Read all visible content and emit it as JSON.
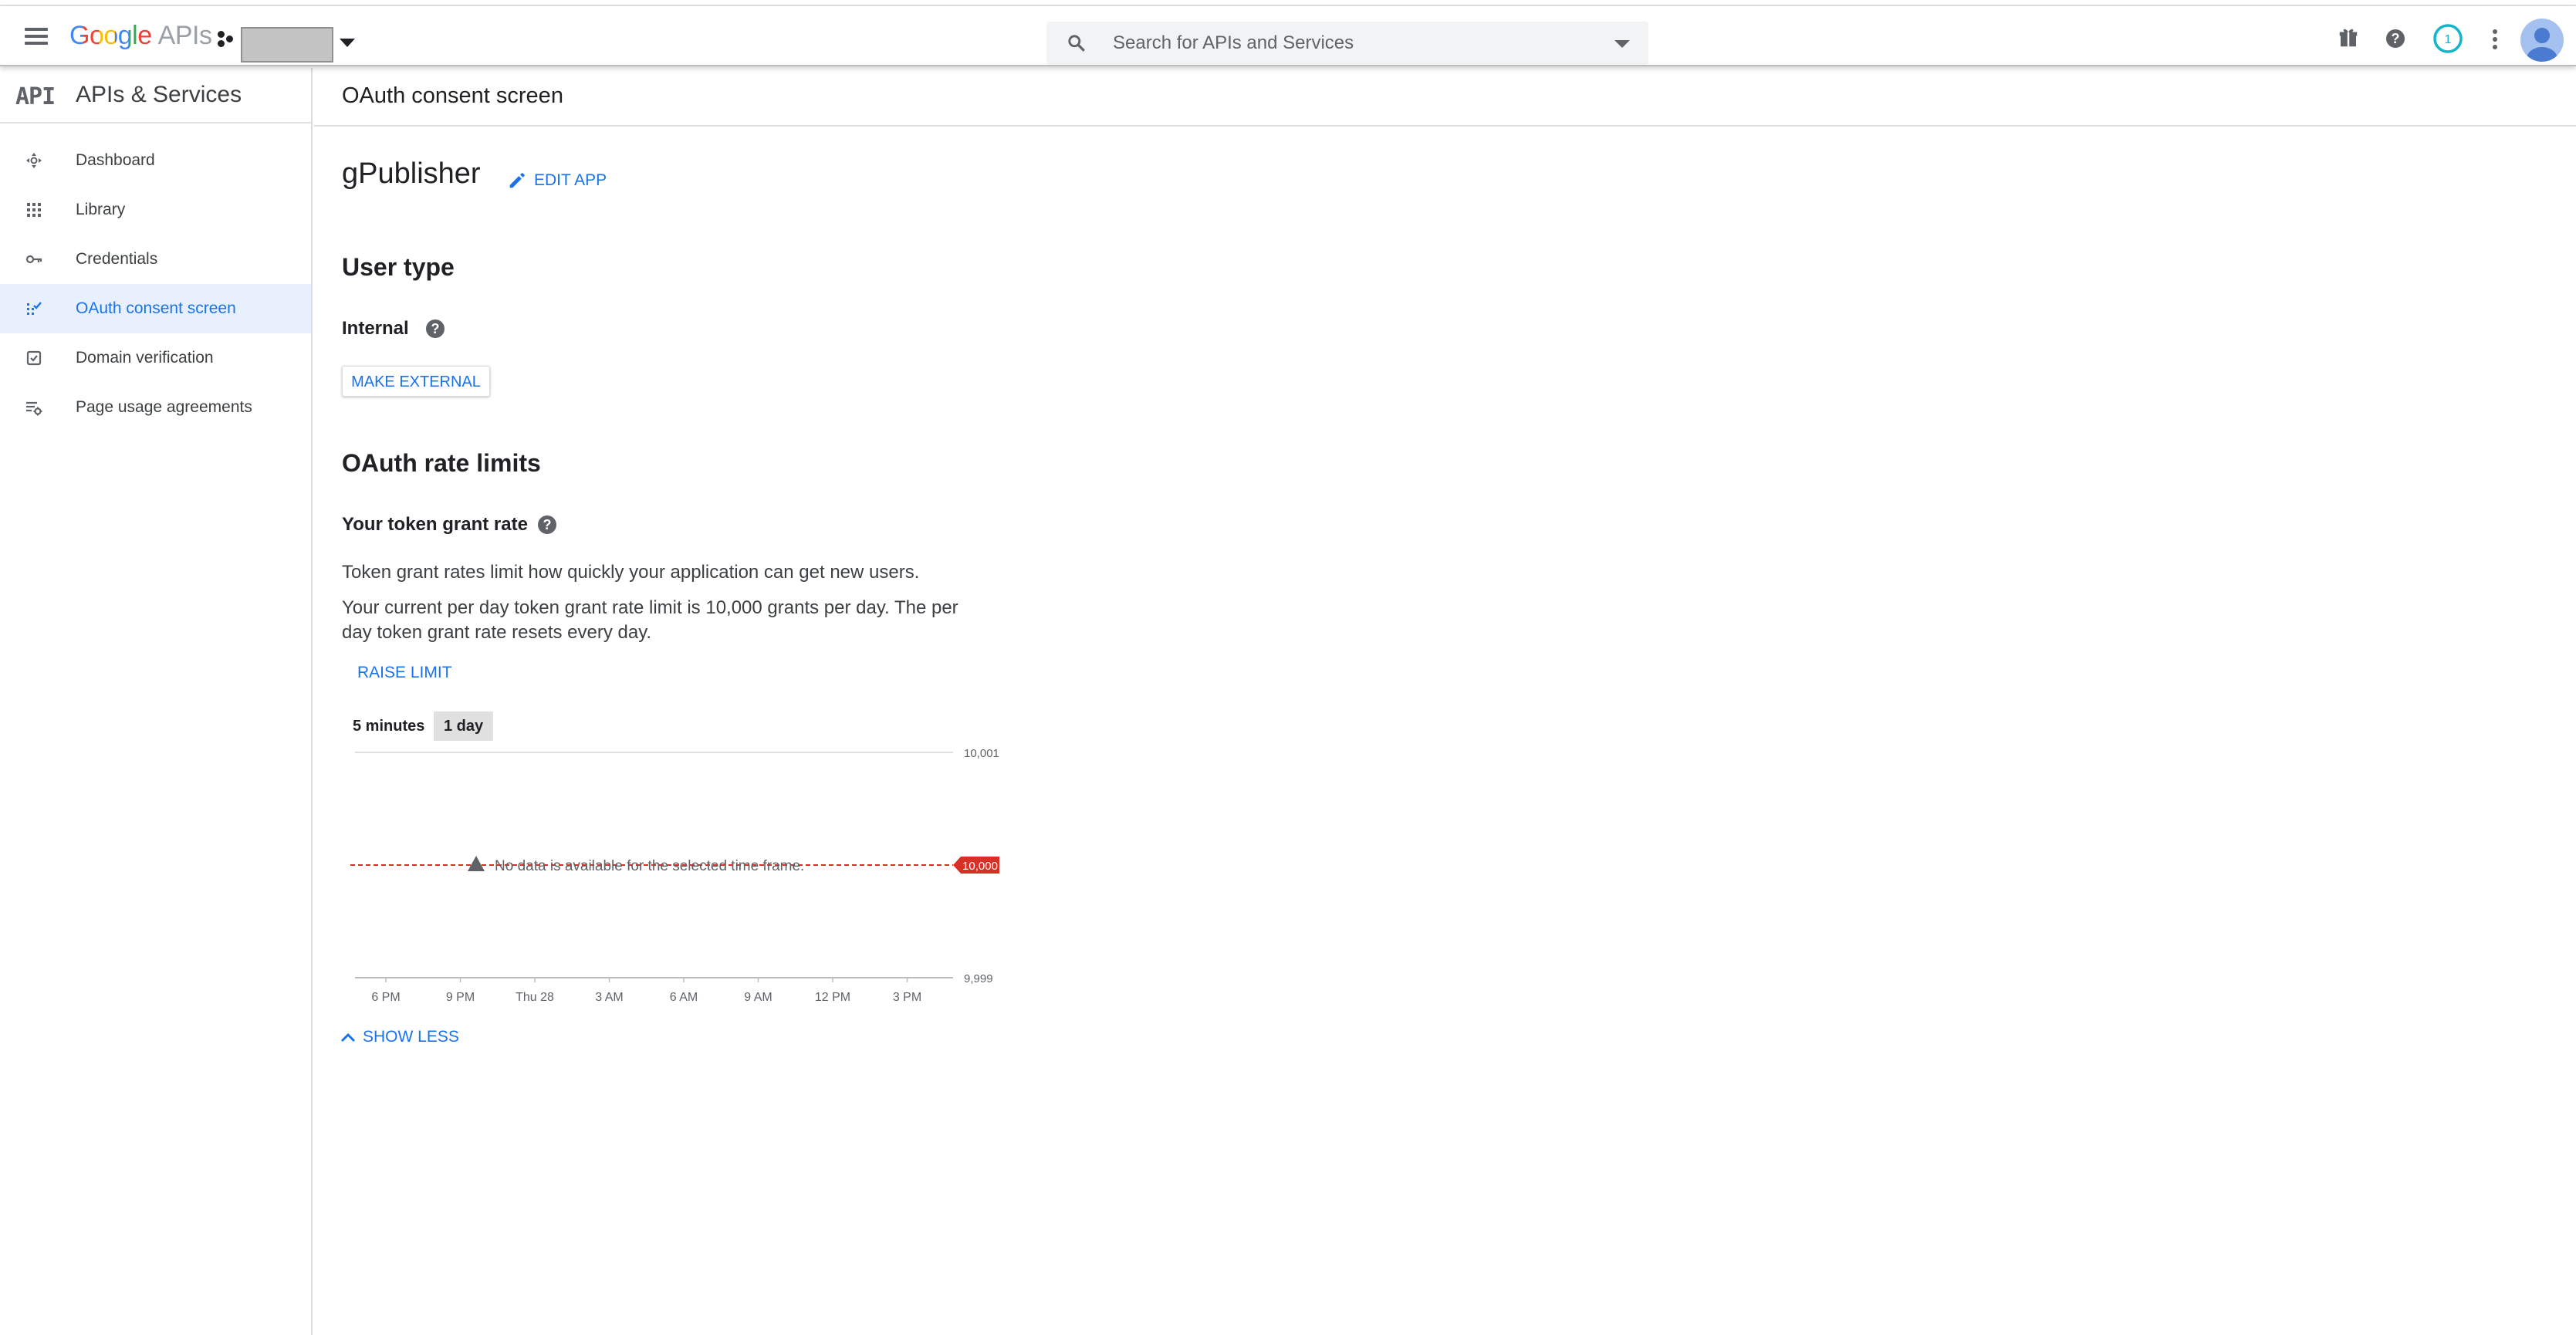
{
  "colors": {
    "accent": "#1a73e8",
    "threshold_line": "#d93025",
    "active_nav_bg": "#e8f0fe"
  },
  "header": {
    "logo_google": "Google",
    "logo_apis": "APIs",
    "search_placeholder": "Search for APIs and Services",
    "notification_count": "1",
    "icons": [
      "menu-icon",
      "project-dots-icon",
      "search-icon",
      "gift-icon",
      "help-icon",
      "notifications-icon",
      "more-vert-icon",
      "avatar"
    ]
  },
  "sidebar": {
    "logo": "API",
    "title": "APIs & Services",
    "items": [
      {
        "label": "Dashboard",
        "icon": "dashboard-icon",
        "active": false
      },
      {
        "label": "Library",
        "icon": "library-icon",
        "active": false
      },
      {
        "label": "Credentials",
        "icon": "key-icon",
        "active": false
      },
      {
        "label": "OAuth consent screen",
        "icon": "consent-icon",
        "active": true
      },
      {
        "label": "Domain verification",
        "icon": "checkbox-icon",
        "active": false
      },
      {
        "label": "Page usage agreements",
        "icon": "settings-list-icon",
        "active": false
      }
    ]
  },
  "main": {
    "page_title": "OAuth consent screen",
    "app_name": "gPublisher",
    "edit_app": "EDIT APP",
    "user_type_heading": "User type",
    "user_type_value": "Internal",
    "make_external": "MAKE EXTERNAL",
    "rate_limits_heading": "OAuth rate limits",
    "token_rate_label": "Your token grant rate",
    "desc_1": "Token grant rates limit how quickly your application can get new users.",
    "desc_2": "Your current per day token grant rate limit is 10,000 grants per day. The per day token grant rate resets every day.",
    "raise_limit": "RAISE LIMIT",
    "time_tabs": [
      {
        "label": "5 minutes",
        "selected": false
      },
      {
        "label": "1 day",
        "selected": true
      }
    ],
    "show_less": "SHOW LESS"
  },
  "chart_data": {
    "type": "line",
    "x_tick_labels": [
      "6 PM",
      "9 PM",
      "Thu 28",
      "3 AM",
      "6 AM",
      "9 AM",
      "12 PM",
      "3 PM"
    ],
    "y_tick_labels": [
      "10,001",
      "9,999"
    ],
    "ylim": [
      9999,
      10001
    ],
    "threshold": {
      "value": 10000,
      "label": "10,000",
      "style": "dashed",
      "color": "#d93025"
    },
    "series": [],
    "annotation": "No data is available for the selected time frame.",
    "grid": "horizontal",
    "legend": "none"
  }
}
